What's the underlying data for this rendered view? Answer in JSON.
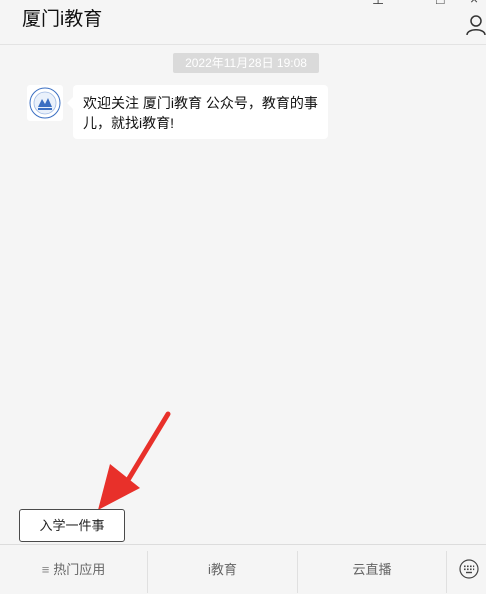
{
  "window": {
    "title": "厦门i教育",
    "pin_icon": "pin-icon",
    "minimize_icon": "minimize-icon",
    "close_icon": "close-icon",
    "profile_icon": "user-icon"
  },
  "chat": {
    "timestamp": "2022年11月28日   19:08",
    "message": {
      "avatar_icon": "account-logo",
      "text_line1": "欢迎关注 厦门i教育 公众号，教育的事",
      "text_line2": "儿，就找i教育!"
    }
  },
  "quick_reply": {
    "label": "入学一件事"
  },
  "menu": {
    "items": [
      {
        "label": "热门应用",
        "icon": "menu-lines-icon"
      },
      {
        "label": "i教育"
      },
      {
        "label": "云直播"
      }
    ],
    "keyboard_icon": "keyboard-icon"
  },
  "colors": {
    "arrow": "#e8302a",
    "background": "#f5f5f5",
    "bubble": "#ffffff"
  }
}
